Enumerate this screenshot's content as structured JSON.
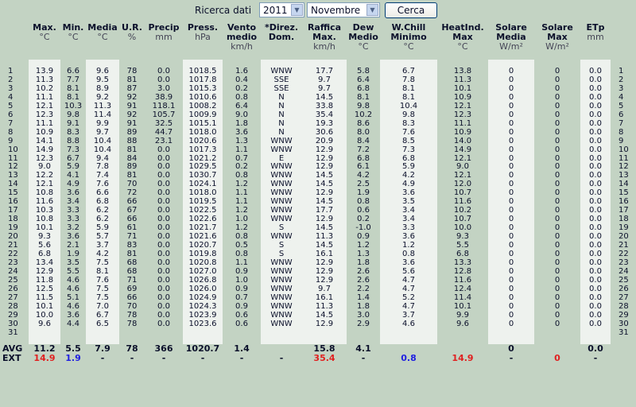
{
  "toolbar": {
    "label": "Ricerca dati",
    "year": "2011",
    "month": "Novembre",
    "button": "Cerca"
  },
  "headers": [
    {
      "t": "Max.",
      "u": "°C"
    },
    {
      "t": "Min.",
      "u": "°C"
    },
    {
      "t": "Media",
      "u": "°C"
    },
    {
      "t": "U.R.",
      "u": "%"
    },
    {
      "t": "Precip",
      "u": "mm"
    },
    {
      "t": "Press.",
      "u": "hPa"
    },
    {
      "t": "Vento medio",
      "u": "km/h"
    },
    {
      "t": "*Direz. Dom.",
      "u": ""
    },
    {
      "t": "Raffica Max.",
      "u": "km/h"
    },
    {
      "t": "Dew Medio",
      "u": "°C"
    },
    {
      "t": "W.Chill Minimo",
      "u": "°C"
    },
    {
      "t": "HeatInd. Max",
      "u": "°C"
    },
    {
      "t": "Solare Media",
      "u": "W/m²"
    },
    {
      "t": "Solare Max",
      "u": "W/m²"
    },
    {
      "t": "ETp",
      "u": "mm"
    }
  ],
  "rows": [
    [
      "1",
      "13.9",
      "6.6",
      "9.6",
      "78",
      "0.0",
      "1018.5",
      "1.6",
      "WNW",
      "17.7",
      "5.8",
      "6.7",
      "13.8",
      "0",
      "0",
      "0.0"
    ],
    [
      "2",
      "11.3",
      "7.7",
      "9.5",
      "81",
      "0.0",
      "1017.8",
      "0.4",
      "SSE",
      "9.7",
      "6.4",
      "7.8",
      "11.3",
      "0",
      "0",
      "0.0"
    ],
    [
      "3",
      "10.2",
      "8.1",
      "8.9",
      "87",
      "3.0",
      "1015.3",
      "0.2",
      "SSE",
      "9.7",
      "6.8",
      "8.1",
      "10.1",
      "0",
      "0",
      "0.0"
    ],
    [
      "4",
      "11.1",
      "8.1",
      "9.2",
      "92",
      "38.9",
      "1010.6",
      "0.8",
      "N",
      "14.5",
      "8.1",
      "8.1",
      "10.9",
      "0",
      "0",
      "0.0"
    ],
    [
      "5",
      "12.1",
      "10.3",
      "11.3",
      "91",
      "118.1",
      "1008.2",
      "6.4",
      "N",
      "33.8",
      "9.8",
      "10.4",
      "12.1",
      "0",
      "0",
      "0.0"
    ],
    [
      "6",
      "12.3",
      "9.8",
      "11.4",
      "92",
      "105.7",
      "1009.9",
      "9.0",
      "N",
      "35.4",
      "10.2",
      "9.8",
      "12.3",
      "0",
      "0",
      "0.0"
    ],
    [
      "7",
      "11.1",
      "9.1",
      "9.9",
      "91",
      "32.5",
      "1015.1",
      "1.8",
      "N",
      "19.3",
      "8.6",
      "8.3",
      "11.1",
      "0",
      "0",
      "0.0"
    ],
    [
      "8",
      "10.9",
      "8.3",
      "9.7",
      "89",
      "44.7",
      "1018.0",
      "3.6",
      "N",
      "30.6",
      "8.0",
      "7.6",
      "10.9",
      "0",
      "0",
      "0.0"
    ],
    [
      "9",
      "14.1",
      "8.8",
      "10.4",
      "88",
      "23.1",
      "1020.6",
      "1.3",
      "WNW",
      "20.9",
      "8.4",
      "8.5",
      "14.0",
      "0",
      "0",
      "0.0"
    ],
    [
      "10",
      "14.9",
      "7.3",
      "10.4",
      "81",
      "0.0",
      "1017.3",
      "1.1",
      "WNW",
      "12.9",
      "7.2",
      "7.3",
      "14.9",
      "0",
      "0",
      "0.0"
    ],
    [
      "11",
      "12.3",
      "6.7",
      "9.4",
      "84",
      "0.0",
      "1021.2",
      "0.7",
      "E",
      "12.9",
      "6.8",
      "6.8",
      "12.1",
      "0",
      "0",
      "0.0"
    ],
    [
      "12",
      "9.0",
      "5.9",
      "7.8",
      "89",
      "0.0",
      "1029.5",
      "0.2",
      "WNW",
      "12.9",
      "6.1",
      "5.9",
      "9.0",
      "0",
      "0",
      "0.0"
    ],
    [
      "13",
      "12.2",
      "4.1",
      "7.4",
      "81",
      "0.0",
      "1030.7",
      "0.8",
      "WNW",
      "14.5",
      "4.2",
      "4.2",
      "12.1",
      "0",
      "0",
      "0.0"
    ],
    [
      "14",
      "12.1",
      "4.9",
      "7.6",
      "70",
      "0.0",
      "1024.1",
      "1.2",
      "WNW",
      "14.5",
      "2.5",
      "4.9",
      "12.0",
      "0",
      "0",
      "0.0"
    ],
    [
      "15",
      "10.8",
      "3.6",
      "6.6",
      "72",
      "0.0",
      "1018.0",
      "1.1",
      "WNW",
      "12.9",
      "1.9",
      "3.6",
      "10.7",
      "0",
      "0",
      "0.0"
    ],
    [
      "16",
      "11.6",
      "3.4",
      "6.8",
      "66",
      "0.0",
      "1019.5",
      "1.1",
      "WNW",
      "14.5",
      "0.8",
      "3.5",
      "11.6",
      "0",
      "0",
      "0.0"
    ],
    [
      "17",
      "10.3",
      "3.3",
      "6.2",
      "67",
      "0.0",
      "1022.5",
      "1.2",
      "WNW",
      "17.7",
      "0.6",
      "3.4",
      "10.2",
      "0",
      "0",
      "0.0"
    ],
    [
      "18",
      "10.8",
      "3.3",
      "6.2",
      "66",
      "0.0",
      "1022.6",
      "1.0",
      "WNW",
      "12.9",
      "0.2",
      "3.4",
      "10.7",
      "0",
      "0",
      "0.0"
    ],
    [
      "19",
      "10.1",
      "3.2",
      "5.9",
      "61",
      "0.0",
      "1021.7",
      "1.2",
      "S",
      "14.5",
      "-1.0",
      "3.3",
      "10.0",
      "0",
      "0",
      "0.0"
    ],
    [
      "20",
      "9.3",
      "3.6",
      "5.7",
      "71",
      "0.0",
      "1021.6",
      "0.8",
      "WNW",
      "11.3",
      "0.9",
      "3.6",
      "9.3",
      "0",
      "0",
      "0.0"
    ],
    [
      "21",
      "5.6",
      "2.1",
      "3.7",
      "83",
      "0.0",
      "1020.7",
      "0.5",
      "S",
      "14.5",
      "1.2",
      "1.2",
      "5.5",
      "0",
      "0",
      "0.0"
    ],
    [
      "22",
      "6.8",
      "1.9",
      "4.2",
      "81",
      "0.0",
      "1019.8",
      "0.8",
      "S",
      "16.1",
      "1.3",
      "0.8",
      "6.8",
      "0",
      "0",
      "0.0"
    ],
    [
      "23",
      "13.4",
      "3.5",
      "7.5",
      "68",
      "0.0",
      "1020.8",
      "1.1",
      "WNW",
      "12.9",
      "1.8",
      "3.6",
      "13.3",
      "0",
      "0",
      "0.0"
    ],
    [
      "24",
      "12.9",
      "5.5",
      "8.1",
      "68",
      "0.0",
      "1027.0",
      "0.9",
      "WNW",
      "12.9",
      "2.6",
      "5.6",
      "12.8",
      "0",
      "0",
      "0.0"
    ],
    [
      "25",
      "11.8",
      "4.6",
      "7.6",
      "71",
      "0.0",
      "1026.8",
      "1.0",
      "WNW",
      "12.9",
      "2.6",
      "4.7",
      "11.6",
      "0",
      "0",
      "0.0"
    ],
    [
      "26",
      "12.5",
      "4.6",
      "7.5",
      "69",
      "0.0",
      "1026.0",
      "0.9",
      "WNW",
      "9.7",
      "2.2",
      "4.7",
      "12.4",
      "0",
      "0",
      "0.0"
    ],
    [
      "27",
      "11.5",
      "5.1",
      "7.5",
      "66",
      "0.0",
      "1024.9",
      "0.7",
      "WNW",
      "16.1",
      "1.4",
      "5.2",
      "11.4",
      "0",
      "0",
      "0.0"
    ],
    [
      "28",
      "10.1",
      "4.6",
      "7.0",
      "70",
      "0.0",
      "1024.3",
      "0.9",
      "WNW",
      "11.3",
      "1.8",
      "4.7",
      "10.1",
      "0",
      "0",
      "0.0"
    ],
    [
      "29",
      "10.0",
      "3.6",
      "6.7",
      "78",
      "0.0",
      "1023.9",
      "0.6",
      "WNW",
      "14.5",
      "3.0",
      "3.7",
      "9.9",
      "0",
      "0",
      "0.0"
    ],
    [
      "30",
      "9.6",
      "4.4",
      "6.5",
      "78",
      "0.0",
      "1023.6",
      "0.6",
      "WNW",
      "12.9",
      "2.9",
      "4.6",
      "9.6",
      "0",
      "0",
      "0.0"
    ],
    [
      "31",
      "",
      "",
      "",
      "",
      "",
      "",
      "",
      "",
      "",
      "",
      "",
      "",
      "",
      "",
      ""
    ]
  ],
  "avg": {
    "label": "AVG",
    "values": [
      "11.2",
      "5.5",
      "7.9",
      "78",
      "366",
      "1020.7",
      "1.4",
      "",
      "15.8",
      "4.1",
      "",
      "",
      "0",
      "",
      "0.0"
    ]
  },
  "ext": {
    "label": "EXT",
    "values": [
      "14.9",
      "1.9",
      "-",
      "-",
      "-",
      "-",
      "-",
      "-",
      "35.4",
      "-",
      "0.8",
      "14.9",
      "-",
      "0",
      "-"
    ],
    "colors": [
      "red",
      "blue",
      "",
      "",
      "",
      "",
      "",
      "",
      "red",
      "",
      "blue",
      "red",
      "",
      "red",
      ""
    ]
  }
}
